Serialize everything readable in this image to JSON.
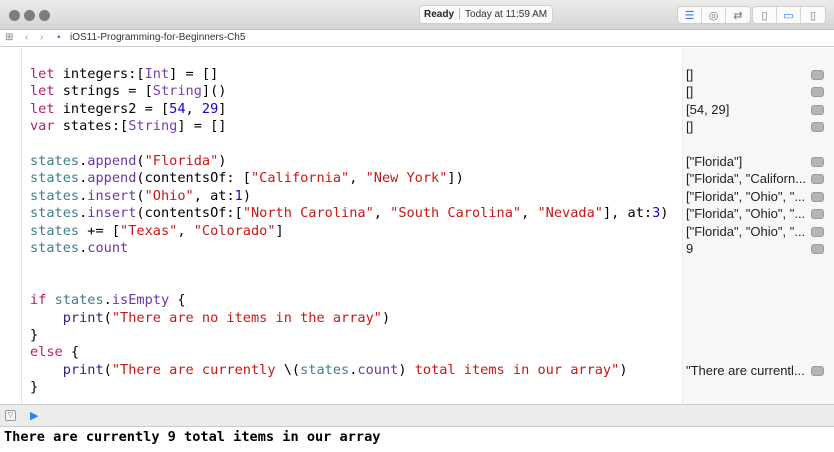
{
  "window": {
    "status_ready": "Ready",
    "status_time": "Today at 11:59 AM"
  },
  "nav": {
    "file_name": "iOS11-Programming-for-Beginners-Ch5"
  },
  "colors": {
    "keyword": "#b5206e",
    "type": "#7a3fae",
    "number": "#1c00cf",
    "string": "#c41a16",
    "identifier": "#3e8087",
    "accent": "#2d7ff9"
  },
  "code_lines": [
    [
      [
        "kw",
        "let"
      ],
      [
        "pl",
        " integers:["
      ],
      [
        "ty",
        "Int"
      ],
      [
        "pl",
        "] = []"
      ]
    ],
    [
      [
        "kw",
        "let"
      ],
      [
        "pl",
        " strings = ["
      ],
      [
        "ty",
        "String"
      ],
      [
        "pl",
        "]()"
      ]
    ],
    [
      [
        "kw",
        "let"
      ],
      [
        "pl",
        " integers2 = ["
      ],
      [
        "num",
        "54"
      ],
      [
        "pl",
        ", "
      ],
      [
        "num",
        "29"
      ],
      [
        "pl",
        "]"
      ]
    ],
    [
      [
        "kw",
        "var"
      ],
      [
        "pl",
        " states:["
      ],
      [
        "ty",
        "String"
      ],
      [
        "pl",
        "] = []"
      ]
    ],
    [],
    [
      [
        "id",
        "states"
      ],
      [
        "pl",
        "."
      ],
      [
        "fn",
        "append"
      ],
      [
        "pl",
        "("
      ],
      [
        "str",
        "\"Florida\""
      ],
      [
        "pl",
        ")"
      ]
    ],
    [
      [
        "id",
        "states"
      ],
      [
        "pl",
        "."
      ],
      [
        "fn",
        "append"
      ],
      [
        "pl",
        "(contentsOf: ["
      ],
      [
        "str",
        "\"California\""
      ],
      [
        "pl",
        ", "
      ],
      [
        "str",
        "\"New York\""
      ],
      [
        "pl",
        "])"
      ]
    ],
    [
      [
        "id",
        "states"
      ],
      [
        "pl",
        "."
      ],
      [
        "fn",
        "insert"
      ],
      [
        "pl",
        "("
      ],
      [
        "str",
        "\"Ohio\""
      ],
      [
        "pl",
        ", at:"
      ],
      [
        "num",
        "1"
      ],
      [
        "pl",
        ")"
      ]
    ],
    [
      [
        "id",
        "states"
      ],
      [
        "pl",
        "."
      ],
      [
        "fn",
        "insert"
      ],
      [
        "pl",
        "(contentsOf:["
      ],
      [
        "str",
        "\"North Carolina\""
      ],
      [
        "pl",
        ", "
      ],
      [
        "str",
        "\"South Carolina\""
      ],
      [
        "pl",
        ", "
      ],
      [
        "str",
        "\"Nevada\""
      ],
      [
        "pl",
        "], at:"
      ],
      [
        "num",
        "3"
      ],
      [
        "pl",
        ")"
      ]
    ],
    [
      [
        "id",
        "states"
      ],
      [
        "pl",
        " += ["
      ],
      [
        "str",
        "\"Texas\""
      ],
      [
        "pl",
        ", "
      ],
      [
        "str",
        "\"Colorado\""
      ],
      [
        "pl",
        "]"
      ]
    ],
    [
      [
        "id",
        "states"
      ],
      [
        "pl",
        "."
      ],
      [
        "fn",
        "count"
      ]
    ],
    [],
    [],
    [
      [
        "kw",
        "if"
      ],
      [
        "pl",
        " "
      ],
      [
        "id",
        "states"
      ],
      [
        "pl",
        "."
      ],
      [
        "fn",
        "isEmpty"
      ],
      [
        "pl",
        " {"
      ]
    ],
    [
      [
        "pl",
        "    "
      ],
      [
        "pr",
        "print"
      ],
      [
        "pl",
        "("
      ],
      [
        "str",
        "\"There are no items in the array\""
      ],
      [
        "pl",
        ")"
      ]
    ],
    [
      [
        "pl",
        "}"
      ]
    ],
    [
      [
        "kw",
        "else"
      ],
      [
        "pl",
        " {"
      ]
    ],
    [
      [
        "pl",
        "    "
      ],
      [
        "pr",
        "print"
      ],
      [
        "pl",
        "("
      ],
      [
        "str",
        "\"There are currently "
      ],
      [
        "pl",
        "\\("
      ],
      [
        "id",
        "states"
      ],
      [
        "pl",
        "."
      ],
      [
        "fn",
        "count"
      ],
      [
        "pl",
        ")"
      ],
      [
        "str",
        " total items in our array\""
      ],
      [
        "pl",
        ")"
      ]
    ],
    [
      [
        "pl",
        "}"
      ]
    ]
  ],
  "results": [
    {
      "line": 0,
      "text": "[]"
    },
    {
      "line": 1,
      "text": "[]"
    },
    {
      "line": 2,
      "text": "[54, 29]"
    },
    {
      "line": 3,
      "text": "[]"
    },
    {
      "line": 5,
      "text": "[\"Florida\"]"
    },
    {
      "line": 6,
      "text": "[\"Florida\", \"Californ..."
    },
    {
      "line": 7,
      "text": "[\"Florida\", \"Ohio\", \"..."
    },
    {
      "line": 8,
      "text": "[\"Florida\", \"Ohio\", \"..."
    },
    {
      "line": 9,
      "text": "[\"Florida\", \"Ohio\", \"..."
    },
    {
      "line": 10,
      "text": "9"
    },
    {
      "line": 17,
      "text": "\"There are currentl..."
    }
  ],
  "console": {
    "output": "There are currently 9 total items in our array"
  }
}
